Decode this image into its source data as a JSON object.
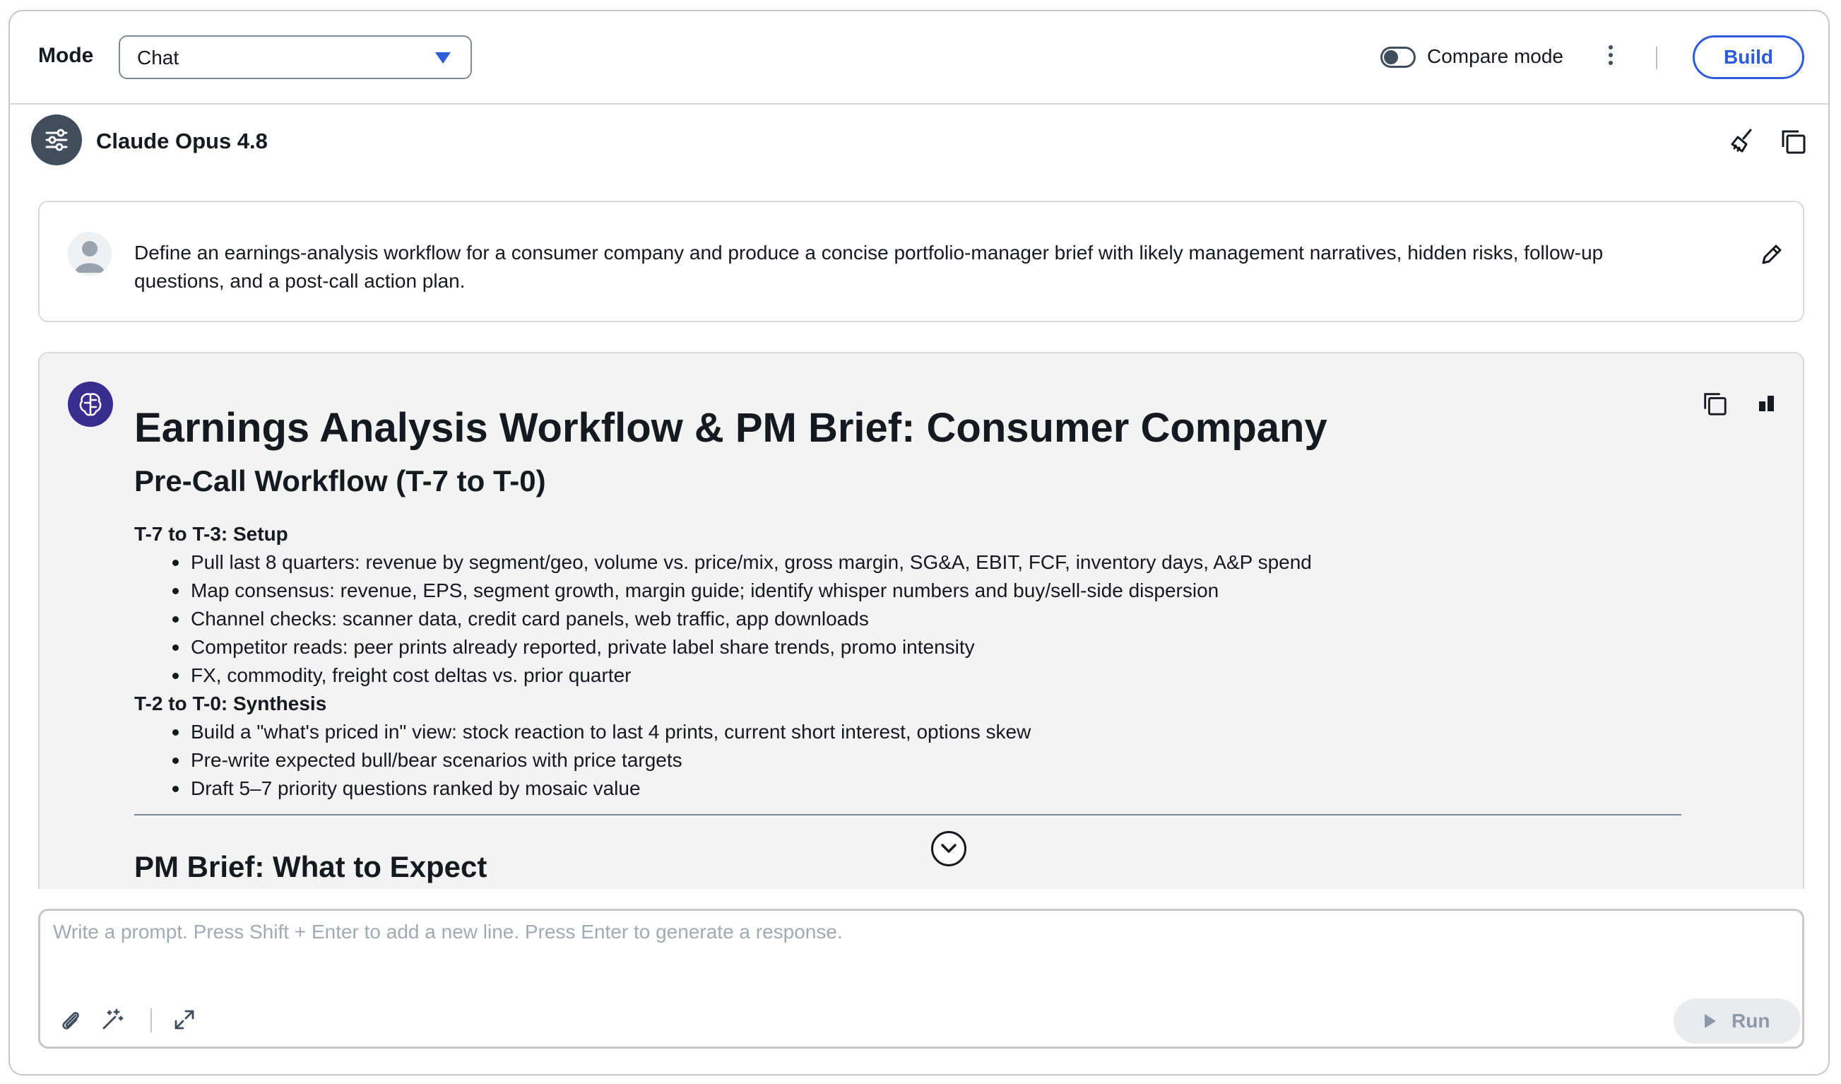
{
  "header": {
    "mode_label": "Mode",
    "mode_value": "Chat",
    "compare_label": "Compare mode",
    "build_label": "Build"
  },
  "model": {
    "name": "Claude Opus 4.8"
  },
  "user_message": {
    "text": "Define an earnings-analysis workflow for a consumer company and produce a concise portfolio-manager brief with likely management narratives, hidden risks, follow-up questions, and a post-call action plan."
  },
  "response": {
    "title": "Earnings Analysis Workflow & PM Brief: Consumer Company",
    "subtitle": "Pre-Call Workflow (T-7 to T-0)",
    "sections": [
      {
        "heading": "T-7 to T-3: Setup",
        "items": [
          "Pull last 8 quarters: revenue by segment/geo, volume vs. price/mix, gross margin, SG&A, EBIT, FCF, inventory days, A&P spend",
          "Map consensus: revenue, EPS, segment growth, margin guide; identify whisper numbers and buy/sell-side dispersion",
          "Channel checks: scanner data, credit card panels, web traffic, app downloads",
          "Competitor reads: peer prints already reported, private label share trends, promo intensity",
          "FX, commodity, freight cost deltas vs. prior quarter"
        ]
      },
      {
        "heading": "T-2 to T-0: Synthesis",
        "items": [
          "Build a \"what's priced in\" view: stock reaction to last 4 prints, current short interest, options skew",
          "Pre-write expected bull/bear scenarios with price targets",
          "Draft 5–7 priority questions ranked by mosaic value"
        ]
      }
    ],
    "next_heading": "PM Brief: What to Expect"
  },
  "prompt": {
    "placeholder": "Write a prompt. Press Shift + Enter to add a new line. Press Enter to generate a response.",
    "run_label": "Run"
  },
  "colors": {
    "accent": "#2d5bd9",
    "ai_avatar": "#3b2d8f",
    "model_avatar": "#414d5c",
    "card_bg": "#f3f3f3"
  }
}
